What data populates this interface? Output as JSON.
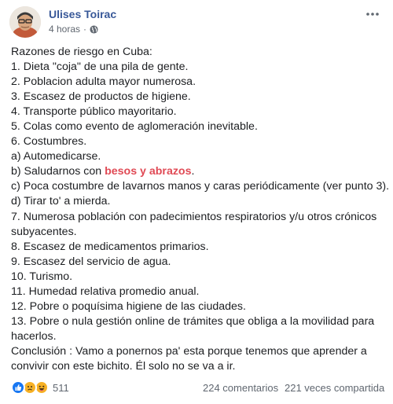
{
  "post": {
    "author": "Ulises Toirac",
    "time": "4 horas",
    "separator": "·",
    "lines": [
      "Razones de riesgo en Cuba:",
      "1. Dieta \"coja\" de una pila de gente.",
      "2. Poblacion adulta mayor numerosa.",
      "3. Escasez de productos de higiene.",
      "4. Transporte público mayoritario.",
      "5. Colas como evento de aglomeración inevitable.",
      "6. Costumbres.",
      "a) Automedicarse."
    ],
    "greeting_line": {
      "prefix": "b) Saludarnos con ",
      "highlight": "besos y abrazos",
      "suffix": "."
    },
    "lines_after": [
      "c) Poca costumbre de lavarnos manos y caras periódicamente (ver punto 3).",
      "d) Tirar to' a mierda.",
      "7. Numerosa población con padecimientos respiratorios y/u otros crónicos subyacentes.",
      "8. Escasez de medicamentos primarios.",
      "9. Escasez del servicio de agua.",
      "10. Turismo.",
      "11. Humedad relativa promedio anual.",
      "12. Pobre o poquísima higiene de las ciudades.",
      "13. Pobre o nula gestión online de trámites que obliga a la movilidad para hacerlos.",
      "Conclusión : Vamo a ponernos pa' esta porque tenemos que aprender a convivir con este bichito. Él solo no se va a ir."
    ]
  },
  "stats": {
    "reactions_count": "511",
    "comments": "224 comentarios",
    "shares": "221 veces compartida"
  },
  "colors": {
    "author": "#385898",
    "highlight": "#e04a55",
    "like": "#1877f2",
    "haha": "#f7b125"
  },
  "icons": [
    "globe-icon",
    "more-icon",
    "like-icon",
    "sad-icon",
    "haha-icon"
  ]
}
